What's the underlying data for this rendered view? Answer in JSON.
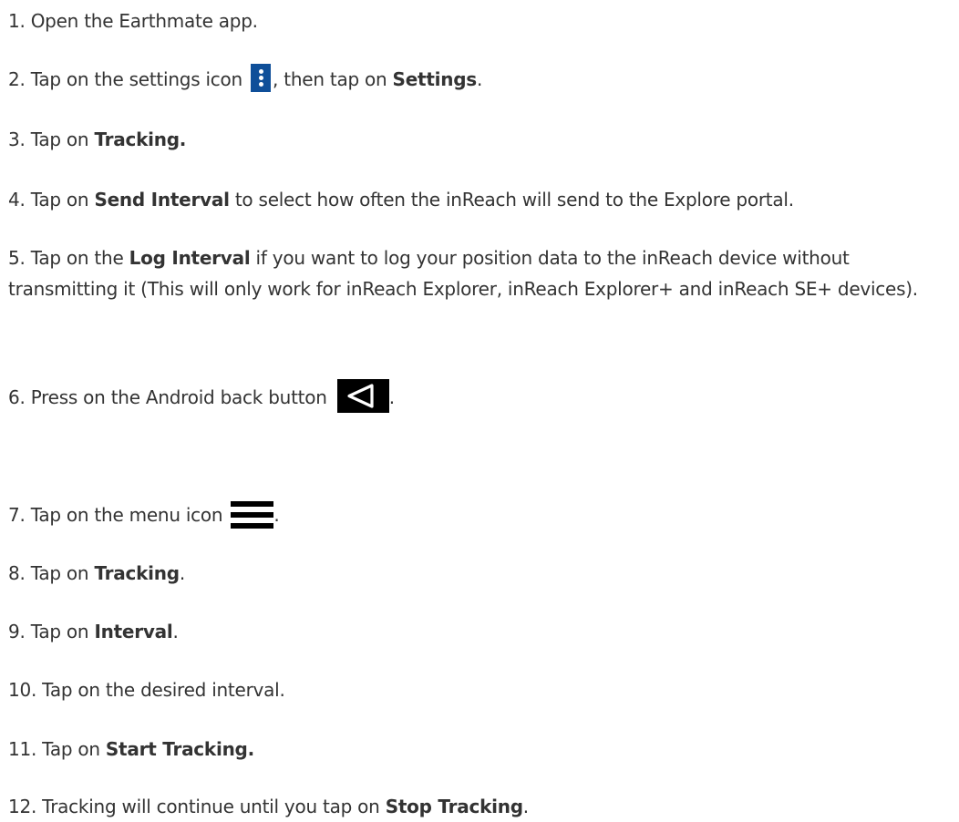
{
  "steps": [
    {
      "parts": [
        "1. Open the Earthmate app."
      ]
    },
    {
      "parts": [
        "2. Tap on the settings icon ",
        ", then tap on ",
        "Settings",
        "."
      ],
      "icon": "kebab-menu-icon"
    },
    {
      "parts": [
        "3. Tap on ",
        "Tracking."
      ]
    },
    {
      "parts": [
        "4. Tap on ",
        "Send Interval",
        " to select how often the inReach will send to the Explore portal."
      ]
    },
    {
      "parts": [
        "5. Tap on the ",
        "Log Interval",
        " if you want to log your position data to the inReach device without transmitting it (This will only work for inReach Explorer, inReach Explorer+ and inReach SE+ devices)."
      ]
    },
    {
      "parts": [
        "6. Press on the Android back button ",
        "."
      ],
      "icon": "android-back-icon"
    },
    {
      "parts": [
        "7. Tap on the menu icon ",
        "."
      ],
      "icon": "hamburger-menu-icon"
    },
    {
      "parts": [
        "8. Tap on ",
        "Tracking",
        "."
      ]
    },
    {
      "parts": [
        "9. Tap on ",
        "Interval",
        "."
      ]
    },
    {
      "parts": [
        "10. Tap on the desired interval."
      ]
    },
    {
      "parts": [
        "11. Tap on ",
        "Start Tracking."
      ]
    },
    {
      "parts": [
        "12. Tracking will continue until you tap on ",
        "Stop Tracking",
        "."
      ]
    }
  ],
  "colors": {
    "text": "#333333",
    "settings_icon_bg": "#0f4f99",
    "back_icon_bg": "#000000",
    "menu_icon_bars": "#000000"
  }
}
